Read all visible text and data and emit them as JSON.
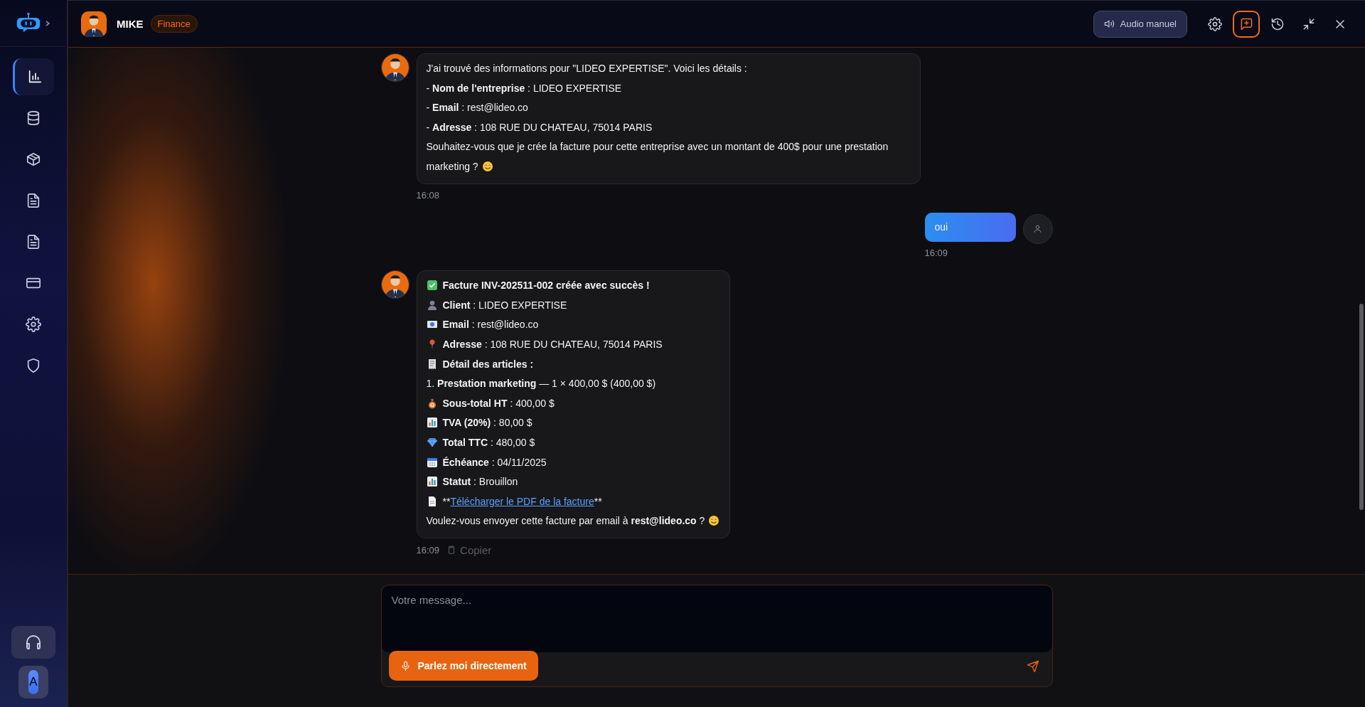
{
  "sidebar": {
    "items": [
      {
        "kind": "chart",
        "selected": true
      },
      {
        "kind": "database",
        "selected": false
      },
      {
        "kind": "box",
        "selected": false
      },
      {
        "kind": "document",
        "selected": false
      },
      {
        "kind": "document",
        "selected": false
      },
      {
        "kind": "card",
        "selected": false
      },
      {
        "kind": "settings",
        "selected": false
      },
      {
        "kind": "shield",
        "selected": false
      }
    ],
    "user_initial": "A"
  },
  "header": {
    "agent_name": "MIKE",
    "department": "Finance",
    "audio_button": "Audio manuel",
    "actions": [
      {
        "kind": "settings",
        "selected": false
      },
      {
        "kind": "new-chat",
        "selected": true
      },
      {
        "kind": "history",
        "selected": false
      },
      {
        "kind": "minimize",
        "selected": false
      },
      {
        "kind": "close",
        "selected": false
      }
    ]
  },
  "messages": [
    {
      "kind": "bot",
      "time": "16:08",
      "lines": [
        {
          "kind": "plain",
          "bold": false,
          "text": "J'ai trouvé des informations pour \"LIDEO EXPERTISE\". Voici les détails :"
        },
        {
          "kind": "plain",
          "bold": false,
          "text": "- **Nom de l'entreprise** : LIDEO EXPERTISE"
        },
        {
          "kind": "plain",
          "bold": false,
          "text": "- **Email** : rest@lideo.co"
        },
        {
          "kind": "plain",
          "bold": false,
          "text": "- **Adresse** : 108 RUE DU CHATEAU, 75014 PARIS"
        },
        {
          "kind": "plain",
          "bold": false,
          "smiley": true,
          "text": "Souhaitez-vous que je crée la facture pour cette entreprise avec un montant de 400$ pour une prestation marketing ?"
        }
      ]
    },
    {
      "kind": "user",
      "time": "16:09",
      "lines": [
        {
          "kind": "plain",
          "bold": false,
          "text": "oui"
        }
      ]
    },
    {
      "kind": "bot",
      "time": "16:09",
      "copy_label": "Copier",
      "lines": [
        {
          "kind": "check",
          "bold": true,
          "text": "Facture INV-202511-002 créée avec succès !"
        },
        {
          "kind": "person",
          "bold": false,
          "text": "**Client** : LIDEO EXPERTISE"
        },
        {
          "kind": "email",
          "bold": false,
          "text": "**Email** : rest@lideo.co"
        },
        {
          "kind": "pin",
          "bold": false,
          "text": "**Adresse** : 108 RUE DU CHATEAU, 75014 PARIS"
        },
        {
          "kind": "receipt",
          "bold": true,
          "text": "Détail des articles :"
        },
        {
          "kind": "plain",
          "bold": false,
          "text": "1. **Prestation marketing** — 1 × 400,00 $ (400,00 $)"
        },
        {
          "kind": "moneybag",
          "bold": false,
          "text": "**Sous-total HT** : 400,00 $"
        },
        {
          "kind": "chart",
          "bold": false,
          "text": "**TVA (20%)** : 80,00 $"
        },
        {
          "kind": "gem",
          "bold": false,
          "text": "**Total TTC** : 480,00 $"
        },
        {
          "kind": "calendar",
          "bold": false,
          "text": "**Échéance** : 04/11/2025"
        },
        {
          "kind": "chart",
          "bold": false,
          "text": "**Statut** : Brouillon"
        },
        {
          "kind": "page",
          "bold": false,
          "before": "**",
          "link": "Télécharger le PDF de la facture",
          "after": "**"
        },
        {
          "kind": "plain",
          "bold": false,
          "smiley": true,
          "text": "Voulez-vous envoyer cette facture par email à **rest@lideo.co** ?"
        }
      ]
    }
  ],
  "composer": {
    "placeholder": "Votre message...",
    "voice_button": "Parlez moi directement"
  }
}
